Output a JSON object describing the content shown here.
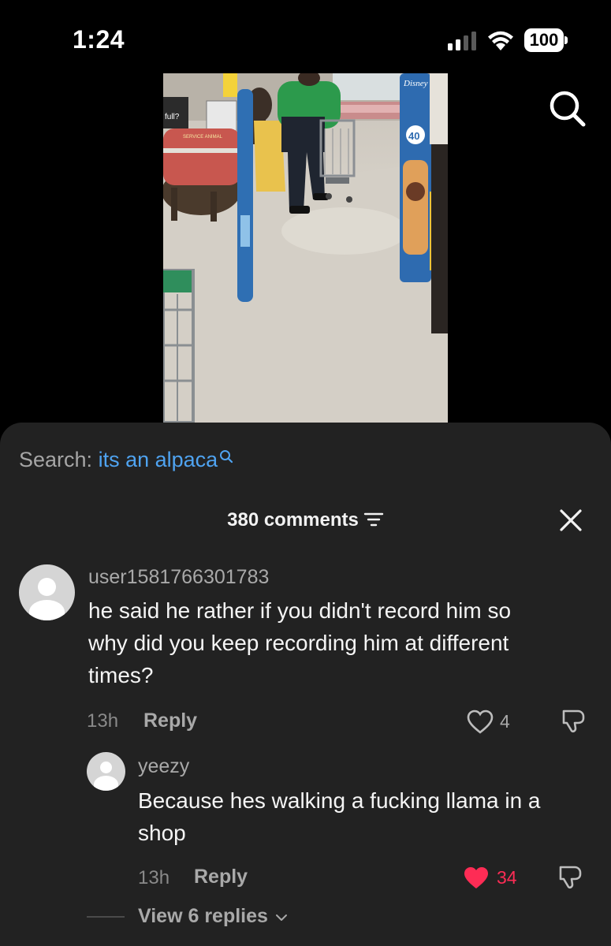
{
  "status_bar": {
    "time": "1:24",
    "battery": "100"
  },
  "video": {
    "sign_full": "full?",
    "vest_text": "SERVICE ANIMAL",
    "display_text": "40",
    "brand_text": "Disney"
  },
  "search": {
    "prefix": "Search:",
    "query": "its an alpaca"
  },
  "comments_header": {
    "count_label": "380 comments"
  },
  "comments": [
    {
      "username": "user1581766301783",
      "text": "he said he rather if you didn't record him so why did you keep recording him at different times?",
      "line1": "he said he rather if you didn't record him so",
      "line2": "why did you keep recording him at different",
      "line3": "times?",
      "age": "13h",
      "reply_label": "Reply",
      "likes": "4"
    }
  ],
  "replies": [
    {
      "username": "yeezy",
      "line1": "Because hes walking a fucking llama in a",
      "line2": "shop",
      "age": "13h",
      "reply_label": "Reply",
      "likes": "34",
      "liked": true
    }
  ],
  "view_replies_label": "View 6 replies",
  "colors": {
    "sheet_bg": "#222222",
    "search_query": "#4fa3f0",
    "like_red": "#fe2c55"
  }
}
